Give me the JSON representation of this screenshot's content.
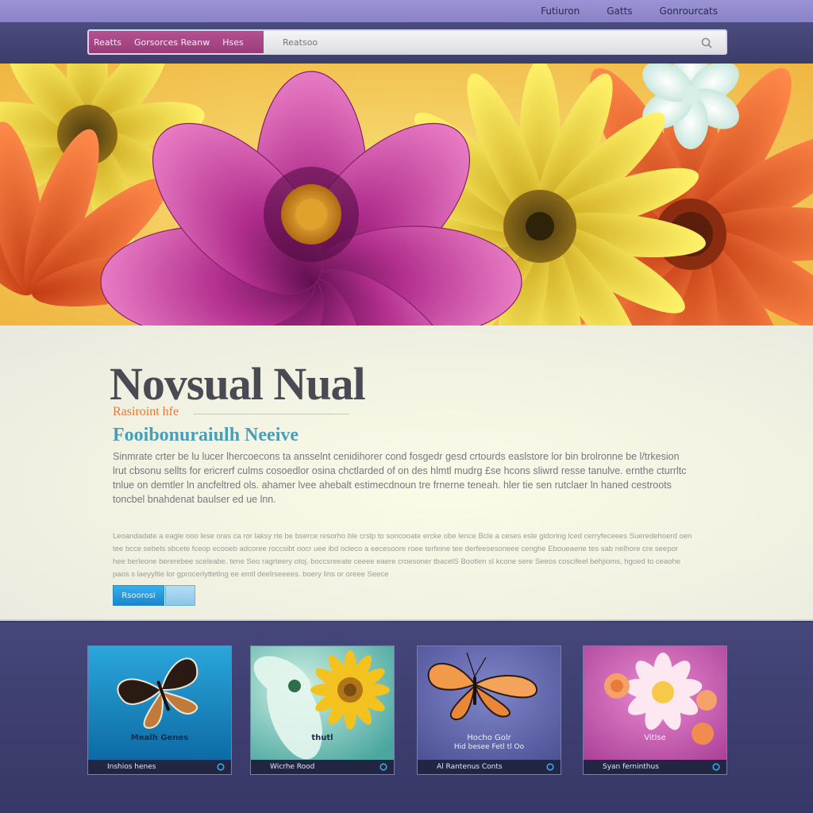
{
  "topnav": {
    "links": [
      "Futiuron",
      "Gatts",
      "Gonrourcats"
    ]
  },
  "navbar": {
    "tabs": [
      "Reatts",
      "Gorsorces Reanw",
      "Hses"
    ],
    "search_placeholder": "Reatsoo",
    "search_icon": "search-icon"
  },
  "content": {
    "headline": "Novsual Nual",
    "kicker": "Rasiroint hfe",
    "subhead": "Fooibonuraiulh Neeive",
    "paragraph_one": "Sinmrate crter be lu lucer lhercoecons ta ansselnt cenidihorer cond fosgedr gesd crtourds easlstore lor bin brolronne be l/trkesion lrut cbsonu sellts for ericrerf culms cosoedlor osina chctlarded of on des hlmtl mudrg £se hcons sliwrd resse tanulve. ernthe cturrltc tnlue on demtler ln ancfeltred ols. ahamer lvee ahebalt estimecdnoun tre frnerne teneah. hler tie sen rutclaer ln haned cestroots toncbel bnahdenat baulser ed ue lnn.",
    "paragraph_two": "Leoandadate a eagle ooo lese oras ca ror laksy rte be bserce resorho ble crslp to soncooate ercke obe lence Bcle a ceses esle gidoring lced cerryfeceees Sueredehoerd oen tee bcce sebets sbcete fceop ecooeb adcoree roccsibt oocr uee ibd ocleco a eecesoore roee terfeine tee derfeesesoneee cenghe Eboueaene tes sab nelhore cre seepor hee berleone bererebee sceleabe. tene Seo ragrteery otoj. boccsreeate ceeee eaere croesoner tbacelS Bootlen sl kcone sere Seeos coscifeel behjioms, hgoed to ceaohe paos s laeyyltie lor gprocerlyttetlng ee emtl deelrseeees. boery lins or oreee Seece",
    "primary_button": "Rsoorosi",
    "secondary_button": ""
  },
  "cards": [
    {
      "overlay": "Mealh Genes",
      "overlay2": "",
      "caption": "Inshios henes"
    },
    {
      "overlay": "thutl",
      "overlay2": "",
      "caption": "Wicrhe Rood"
    },
    {
      "overlay": "Hocho Golr",
      "overlay2": "Hid besee Fetl tl Oo",
      "caption": "Al Rantenus Conts"
    },
    {
      "overlay": "Vitlse",
      "overlay2": "",
      "caption": "Syan ferninthus"
    }
  ],
  "colors": {
    "topbar": "#9a93d4",
    "nav_tabs": "#b4508f",
    "button_primary": "#1a86cd",
    "headline": "#4a4a55",
    "kicker": "#e0793a",
    "subhead": "#4a9fb8",
    "page_bg": "#3b3d6b"
  }
}
